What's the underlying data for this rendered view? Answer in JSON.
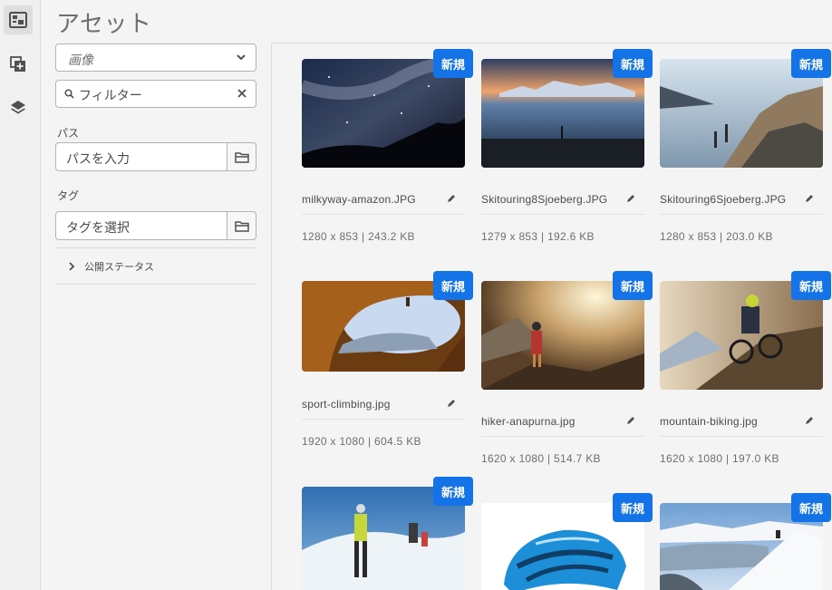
{
  "header": {
    "title": "アセット"
  },
  "rail": {
    "icons": [
      "assets-icon",
      "add-component-icon",
      "layers-icon"
    ]
  },
  "filters": {
    "type_select": {
      "value": "画像"
    },
    "search": {
      "placeholder": "フィルター"
    },
    "path": {
      "label": "パス",
      "placeholder": "パスを入力"
    },
    "tag": {
      "label": "タグ",
      "placeholder": "タグを選択"
    },
    "publish_status": {
      "label": "公開ステータス"
    }
  },
  "badge_label": "新規",
  "colors": {
    "accent": "#1473e6"
  },
  "assets": [
    {
      "filename": "milkyway-amazon.JPG",
      "dimensions": "1280 x 853",
      "size": "243.2 KB"
    },
    {
      "filename": "Skitouring8Sjoeberg.JPG",
      "dimensions": "1279 x 853",
      "size": "192.6 KB"
    },
    {
      "filename": "Skitouring6Sjoeberg.JPG",
      "dimensions": "1280 x 853",
      "size": "203.0 KB"
    },
    {
      "filename": "sport-climbing.jpg",
      "dimensions": "1920 x 1080",
      "size": "604.5 KB"
    },
    {
      "filename": "hiker-anapurna.jpg",
      "dimensions": "1620 x 1080",
      "size": "514.7 KB"
    },
    {
      "filename": "mountain-biking.jpg",
      "dimensions": "1620 x 1080",
      "size": "197.0 KB"
    },
    {
      "filename": "",
      "dimensions": "",
      "size": ""
    },
    {
      "filename": "",
      "dimensions": "",
      "size": ""
    },
    {
      "filename": "",
      "dimensions": "",
      "size": ""
    }
  ]
}
